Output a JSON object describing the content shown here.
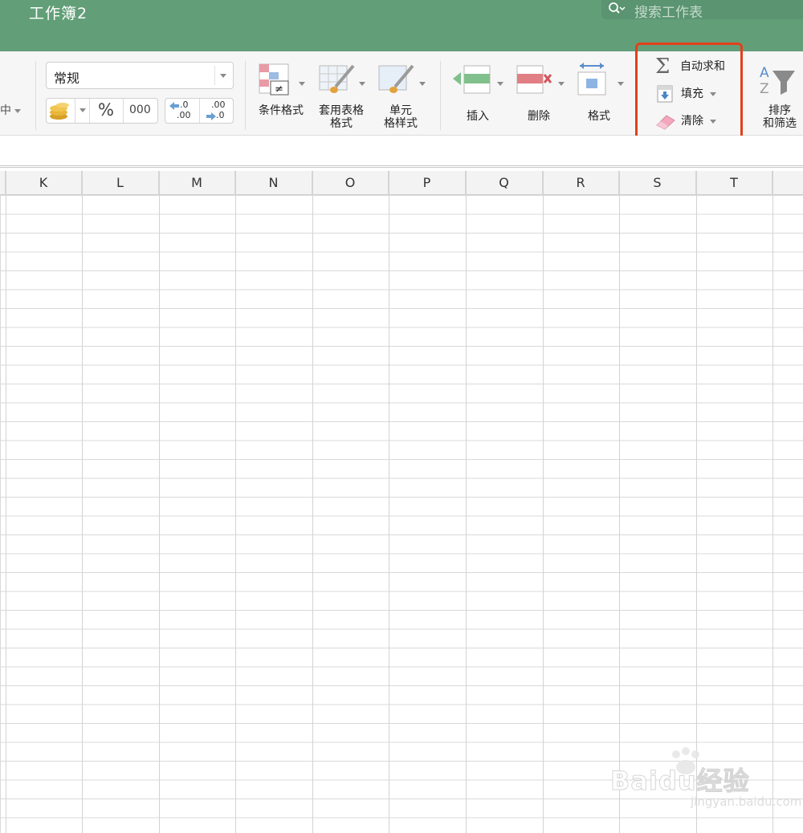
{
  "window": {
    "title": "工作簿2"
  },
  "search": {
    "placeholder": "搜索工作表"
  },
  "ribbon": {
    "number_format": {
      "value": "常规"
    },
    "left_truncated": "中",
    "percent": "%",
    "thousands": "000",
    "dec_increase_top": ".0",
    "dec_increase_bottom": ".00",
    "dec_decrease_top": ".00",
    "dec_decrease_bottom": ".0",
    "conditional_format": "条件格式",
    "table_format": [
      "套用表格",
      "格式"
    ],
    "cell_style": [
      "单元",
      "格样式"
    ],
    "insert": "插入",
    "delete": "删除",
    "format": "格式",
    "autosum": "自动求和",
    "fill": "填充",
    "clear": "清除",
    "sort_filter": [
      "排序",
      "和筛选"
    ]
  },
  "grid": {
    "columns": [
      "K",
      "L",
      "M",
      "N",
      "O",
      "P",
      "Q",
      "R",
      "S",
      "T"
    ]
  },
  "watermark": {
    "brand": "Baidu经验",
    "url": "jingyan.baidu.com"
  },
  "colors": {
    "titlebar": "#629f78",
    "highlight": "#e2401a"
  }
}
